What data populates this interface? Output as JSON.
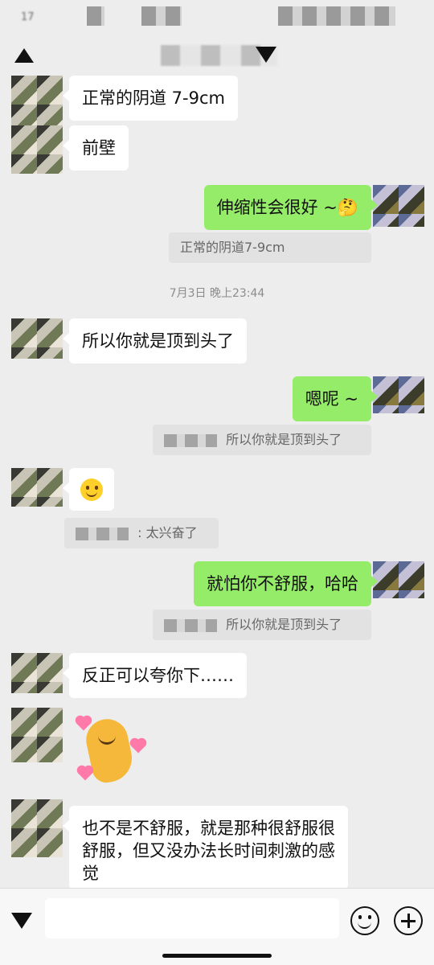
{
  "status_bar": {
    "time": "17"
  },
  "messages": [
    {
      "id": "m1",
      "side": "in",
      "text": "正常的阴道 7-9cm"
    },
    {
      "id": "m2",
      "side": "in",
      "text": "前壁"
    },
    {
      "id": "m3",
      "side": "out",
      "text": "伸缩性会很好 ~🤔"
    },
    {
      "id": "q1",
      "kind": "quote",
      "text": "正常的阴道7-9cm"
    },
    {
      "id": "t1",
      "kind": "timestamp",
      "text": "7月3日 晚上23:44"
    },
    {
      "id": "m4",
      "side": "in",
      "text": "所以你就是顶到头了"
    },
    {
      "id": "m5",
      "side": "out",
      "text": "嗯呢 ~"
    },
    {
      "id": "q2",
      "kind": "quote",
      "text": "所以你就是顶到头了"
    },
    {
      "id": "m6",
      "side": "in",
      "emoji": "smiling-face-icon"
    },
    {
      "id": "q3",
      "kind": "quote",
      "text": ": 太兴奋了"
    },
    {
      "id": "m7",
      "side": "out",
      "text": "就怕你不舒服，哈哈"
    },
    {
      "id": "q4",
      "kind": "quote",
      "text": "所以你就是顶到头了"
    },
    {
      "id": "m8",
      "side": "in",
      "text": "反正可以夸你下……"
    },
    {
      "id": "m9",
      "side": "in",
      "sticker": "heart-sticker"
    },
    {
      "id": "m10",
      "side": "in",
      "lines": [
        "也不是不舒服，就是那种很舒服很",
        "舒服，但又没办法长时间刺激的感",
        "觉"
      ]
    }
  ],
  "input_bar": {
    "placeholder": ""
  }
}
